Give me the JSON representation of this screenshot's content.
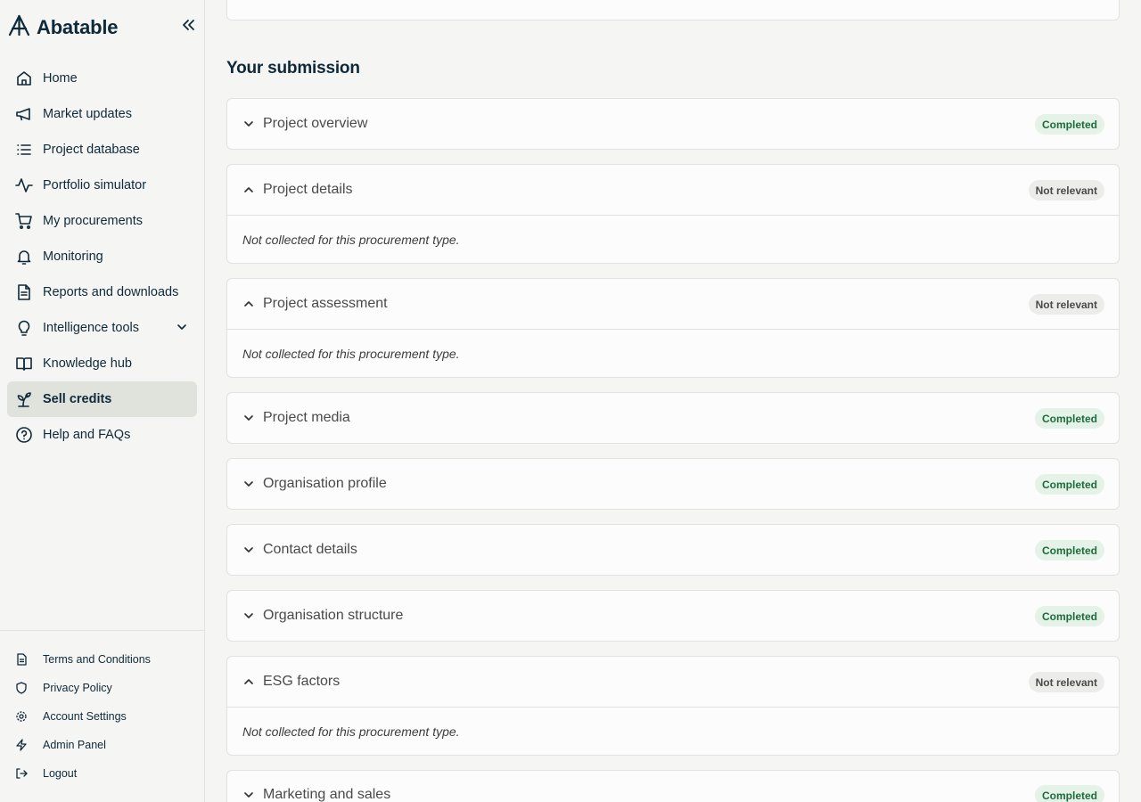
{
  "brand": {
    "name": "Abatable",
    "logo_icon": "abatable-logo-icon",
    "collapse_icon": "double-chevron-left-icon"
  },
  "nav": [
    {
      "label": "Home",
      "icon": "home-icon"
    },
    {
      "label": "Market updates",
      "icon": "megaphone-icon"
    },
    {
      "label": "Project database",
      "icon": "list-icon"
    },
    {
      "label": "Portfolio simulator",
      "icon": "activity-icon"
    },
    {
      "label": "My procurements",
      "icon": "cart-icon"
    },
    {
      "label": "Monitoring",
      "icon": "bell-icon"
    },
    {
      "label": "Reports and downloads",
      "icon": "document-icon"
    },
    {
      "label": "Intelligence tools",
      "icon": "lightbulb-icon",
      "has_submenu": true
    },
    {
      "label": "Knowledge hub",
      "icon": "book-open-icon"
    },
    {
      "label": "Sell credits",
      "icon": "sprout-icon",
      "active": true
    },
    {
      "label": "Help and FAQs",
      "icon": "help-circle-icon"
    }
  ],
  "footer_nav": [
    {
      "label": "Terms and Conditions",
      "icon": "file-text-icon"
    },
    {
      "label": "Privacy Policy",
      "icon": "shield-icon"
    },
    {
      "label": "Account Settings",
      "icon": "gear-icon"
    },
    {
      "label": "Admin Panel",
      "icon": "lightning-icon"
    },
    {
      "label": "Logout",
      "icon": "logout-icon"
    }
  ],
  "main": {
    "section_title": "Your submission",
    "sections": [
      {
        "title": "Project overview",
        "status": "Completed",
        "expanded": false
      },
      {
        "title": "Project details",
        "status": "Not relevant",
        "expanded": true,
        "body": "Not collected for this procurement type."
      },
      {
        "title": "Project assessment",
        "status": "Not relevant",
        "expanded": true,
        "body": "Not collected for this procurement type."
      },
      {
        "title": "Project media",
        "status": "Completed",
        "expanded": false
      },
      {
        "title": "Organisation profile",
        "status": "Completed",
        "expanded": false
      },
      {
        "title": "Contact details",
        "status": "Completed",
        "expanded": false
      },
      {
        "title": "Organisation structure",
        "status": "Completed",
        "expanded": false
      },
      {
        "title": "ESG factors",
        "status": "Not relevant",
        "expanded": true,
        "body": "Not collected for this procurement type."
      },
      {
        "title": "Marketing and sales",
        "status": "Completed",
        "expanded": false
      }
    ]
  },
  "colors": {
    "brand_text": "#0e2a3a",
    "completed_bg": "#e4f2e8",
    "completed_text": "#1e6b3c",
    "not_relevant_bg": "#ececea",
    "active_nav_bg": "#e0e3dc"
  }
}
